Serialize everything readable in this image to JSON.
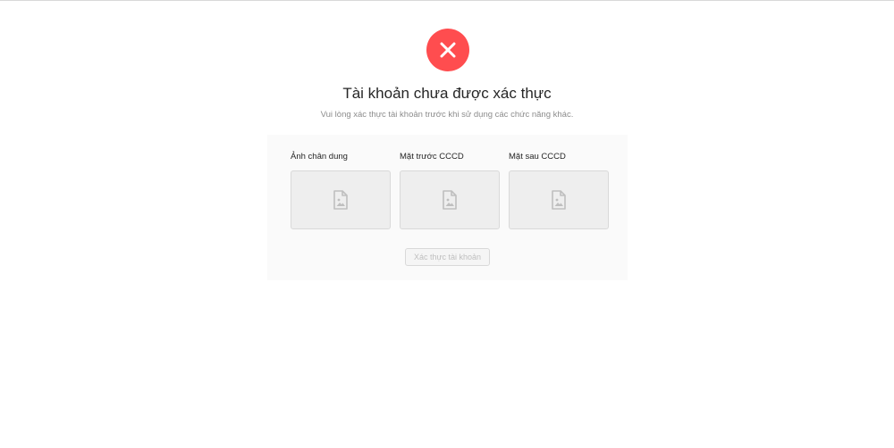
{
  "result": {
    "status_icon": "close-circle-icon",
    "status_color": "#ff4d4f",
    "title": "Tài khoản chưa được xác thực",
    "subtitle": "Vui lòng xác thực tài khoản trước khi sử dụng các chức năng khác."
  },
  "uploads": [
    {
      "label": "Ảnh chân dung",
      "icon": "file-image-icon"
    },
    {
      "label": "Mặt trước CCCD",
      "icon": "file-image-icon"
    },
    {
      "label": "Mặt sau CCCD",
      "icon": "file-image-icon"
    }
  ],
  "actions": {
    "verify_label": "Xác thực tài khoản",
    "verify_disabled": true
  }
}
